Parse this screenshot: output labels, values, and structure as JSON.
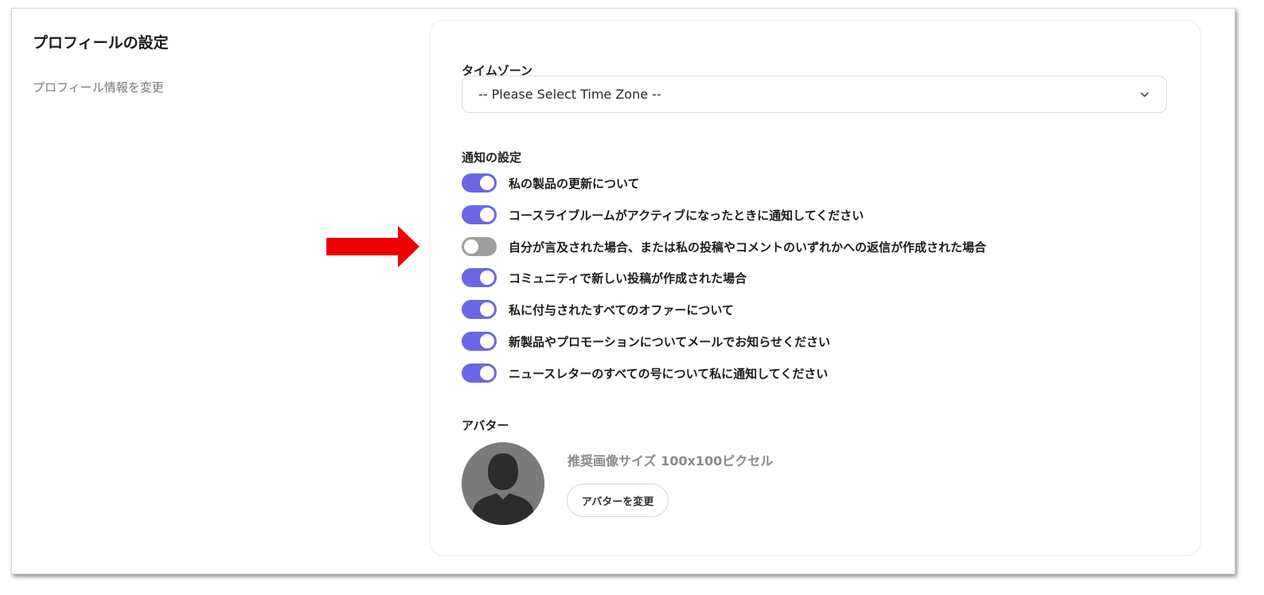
{
  "profile": {
    "title": "プロフィールの設定",
    "description": "プロフィール情報を変更"
  },
  "timezone": {
    "label": "タイムゾーン",
    "selected": "-- Please Select Time Zone --"
  },
  "notifications": {
    "label": "通知の設定",
    "items": [
      {
        "label": "私の製品の更新について",
        "enabled": true
      },
      {
        "label": "コースライブルームがアクティブになったときに通知してください",
        "enabled": true
      },
      {
        "label": "自分が言及された場合、または私の投稿やコメントのいずれかへの返信が作成された場合",
        "enabled": false
      },
      {
        "label": "コミュニティで新しい投稿が作成された場合",
        "enabled": true
      },
      {
        "label": "私に付与されたすべてのオファーについて",
        "enabled": true
      },
      {
        "label": "新製品やプロモーションについてメールでお知らせください",
        "enabled": true
      },
      {
        "label": "ニュースレターのすべての号について私に通知してください",
        "enabled": true
      }
    ]
  },
  "avatar": {
    "label": "アバター",
    "size_hint": "推奨画像サイズ 100x100ピクセル",
    "change_button": "アバターを変更"
  },
  "colors": {
    "toggle_on": "#6a67e6",
    "toggle_off": "#9e9e9e",
    "annotation_arrow": "#ee0000"
  },
  "annotation": {
    "icon": "red-arrow-icon"
  }
}
